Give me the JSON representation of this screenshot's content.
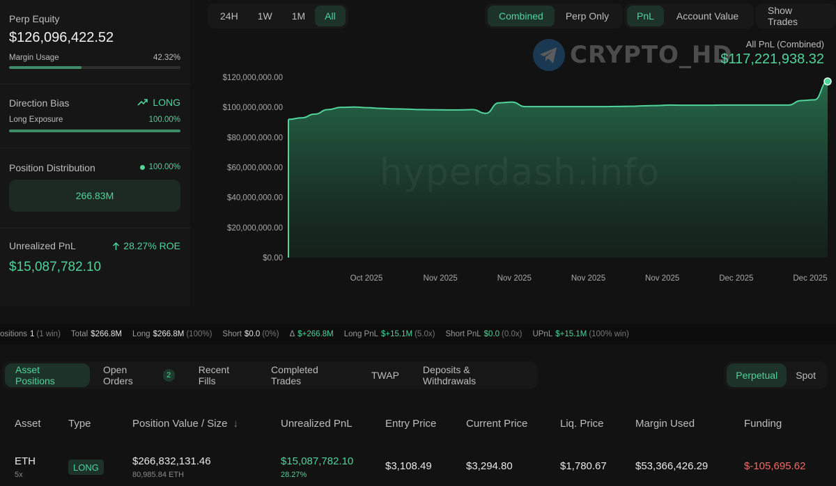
{
  "left": {
    "perp_equity_label": "Perp Equity",
    "perp_equity_value": "$126,096,422.52",
    "margin_usage_label": "Margin Usage",
    "margin_usage_value": "42.32%",
    "margin_usage_fraction": 0.4232,
    "direction_label": "Direction Bias",
    "direction_value": "LONG",
    "long_exposure_label": "Long Exposure",
    "long_exposure_value": "100.00%",
    "long_exposure_fraction": 1.0,
    "distribution_label": "Position Distribution",
    "distribution_value": "100.00%",
    "distribution_box": "266.83M",
    "upnl_label": "Unrealized PnL",
    "upnl_roe": "28.27% ROE",
    "upnl_value": "$15,087,782.10"
  },
  "top": {
    "ranges": [
      "24H",
      "1W",
      "1M",
      "All"
    ],
    "active_range": "All",
    "mode": [
      "Combined",
      "Perp Only"
    ],
    "metric": [
      "PnL",
      "Account Value"
    ],
    "show_trades": "Show Trades"
  },
  "chart_header": {
    "label": "All PnL (Combined)",
    "value": "$117,221,938.32",
    "watermark_brand": "CRYPTO_HD",
    "watermark_site": "hyperdash.info"
  },
  "chart_data": {
    "type": "area",
    "title": "",
    "xlabel": "",
    "ylabel": "",
    "ylim": [
      0,
      120000000
    ],
    "y_ticks": [
      "$120,000,000.00",
      "$100,000,000.00",
      "$80,000,000.00",
      "$60,000,000.00",
      "$40,000,000.00",
      "$20,000,000.00",
      "$0.00"
    ],
    "x_ticks": [
      "Oct 2025",
      "Nov 2025",
      "Nov 2025",
      "Nov 2025",
      "Nov 2025",
      "Dec 2025",
      "Dec 2025"
    ],
    "grid": false,
    "color": "#4fd49a",
    "values": [
      92000000,
      93000000,
      95500000,
      98500000,
      100000000,
      100200000,
      99800000,
      99300000,
      99000000,
      98800000,
      98500000,
      98400000,
      98300000,
      98300000,
      98500000,
      96000000,
      103000000,
      103500000,
      100500000,
      100500000,
      100500000,
      100500000,
      100500000,
      100500000,
      100500000,
      100600000,
      100700000,
      101000000,
      101200000,
      101500000,
      101400000,
      101400000,
      101400000,
      101500000,
      101500000,
      101500000,
      101500000,
      101500000,
      101500000,
      104500000,
      105000000,
      117221938
    ]
  },
  "strip": [
    {
      "label": "ositions",
      "value": "1",
      "note": "(1 win)",
      "green": false
    },
    {
      "label": "Total",
      "value": "$266.8M",
      "note": "",
      "green": false
    },
    {
      "label": "Long",
      "value": "$266.8M",
      "note": "(100%)",
      "green": false
    },
    {
      "label": "Short",
      "value": "$0.0",
      "note": "(0%)",
      "green": false
    },
    {
      "label": "Δ",
      "value": "$+266.8M",
      "note": "",
      "green": true
    },
    {
      "label": "Long PnL",
      "value": "$+15.1M",
      "note": "(5.0x)",
      "green": true
    },
    {
      "label": "Short PnL",
      "value": "$0.0",
      "note": "(0.0x)",
      "green": true
    },
    {
      "label": "UPnL",
      "value": "$+15.1M",
      "note": "(100% win)",
      "green": true
    }
  ],
  "tabs": [
    "Asset Positions",
    "Open Orders",
    "Recent Fills",
    "Completed Trades",
    "TWAP",
    "Deposits & Withdrawals"
  ],
  "open_orders_count": "2",
  "market_type": [
    "Perpetual",
    "Spot"
  ],
  "table": {
    "headers": [
      "Asset",
      "Type",
      "Position Value / Size",
      "Unrealized PnL",
      "Entry Price",
      "Current Price",
      "Liq. Price",
      "Margin Used",
      "Funding"
    ],
    "sort_arrow": "↓",
    "row": {
      "asset": "ETH",
      "leverage": "5x",
      "type": "LONG",
      "position_value": "$266,832,131.46",
      "size": "80,985.84 ETH",
      "upnl": "$15,087,782.10",
      "upnl_pct": "28.27%",
      "entry": "$3,108.49",
      "current": "$3,294.80",
      "liq": "$1,780.67",
      "margin": "$53,366,426.29",
      "funding": "$-105,695.62"
    }
  }
}
